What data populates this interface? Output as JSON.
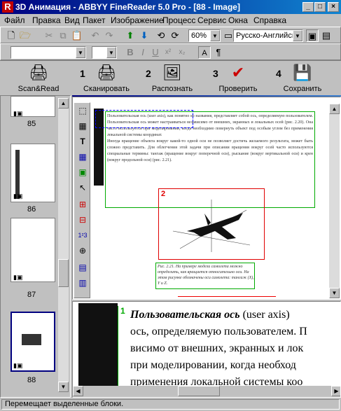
{
  "window": {
    "title": "3D Анимация - ABBYY FineReader 5.0 Pro - [88 - Image]",
    "app_icon": "R"
  },
  "menu": [
    "Файл",
    "Правка",
    "Вид",
    "Пакет",
    "Изображение",
    "Процесс",
    "Сервис",
    "Окна",
    "Справка"
  ],
  "toolbar": {
    "zoom": "60%",
    "language": "Русско-Английский",
    "font_name": "",
    "font_size": ""
  },
  "wizard": {
    "scan_read": "Scan&Read",
    "steps": [
      {
        "num": "1",
        "label": "Сканировать"
      },
      {
        "num": "2",
        "label": "Распознать"
      },
      {
        "num": "3",
        "label": "Проверить"
      },
      {
        "num": "4",
        "label": "Сохранить"
      }
    ]
  },
  "thumbnails": [
    {
      "page": "85"
    },
    {
      "page": "86"
    },
    {
      "page": "87"
    },
    {
      "page": "88"
    }
  ],
  "image": {
    "block1_text": "Пользовательская ось (user axis), как понятно из названия, представляет собой ось, определяемую пользователем. Пользовательская ось может настраиваться независимо от внешних, экранных и локальных осей (рис. 2.20). Она часто используется при моделировании, когда необходимо повернуть объект под особым углом без применения локальной системы координат.",
    "block1_text2": "Иногда вращение объекта вокруг какой-то одной оси не позволяет достичь желаемого результата, может быть сложно представить. Для облегчения этой задачи при описании вращения вокруг осей часто используются специальные термины: тангаж (вращение вокруг поперечной оси), рыскание (вокруг вертикальной оси) и крен (вокруг продольной оси) (рис. 2.21).",
    "block2_num": "2",
    "block3_text": "Рис. 2.21. На примере модели самолета можно определить, как вращается относительно оси. На этом рисунке обозначены оси самолета: тангаж (X), Y и Z."
  },
  "zoom": {
    "block_num": "1",
    "lines": [
      {
        "em": "Пользовательская ось",
        "rest": " (user axis)"
      },
      {
        "text": "ось, определяемую пользователем. П"
      },
      {
        "text": "висимо от внешних, экранных и лок"
      },
      {
        "text": "при моделировании, когда необход"
      },
      {
        "text": "применения локальной системы коо"
      }
    ]
  },
  "status": "Перемещает выделенные блоки."
}
